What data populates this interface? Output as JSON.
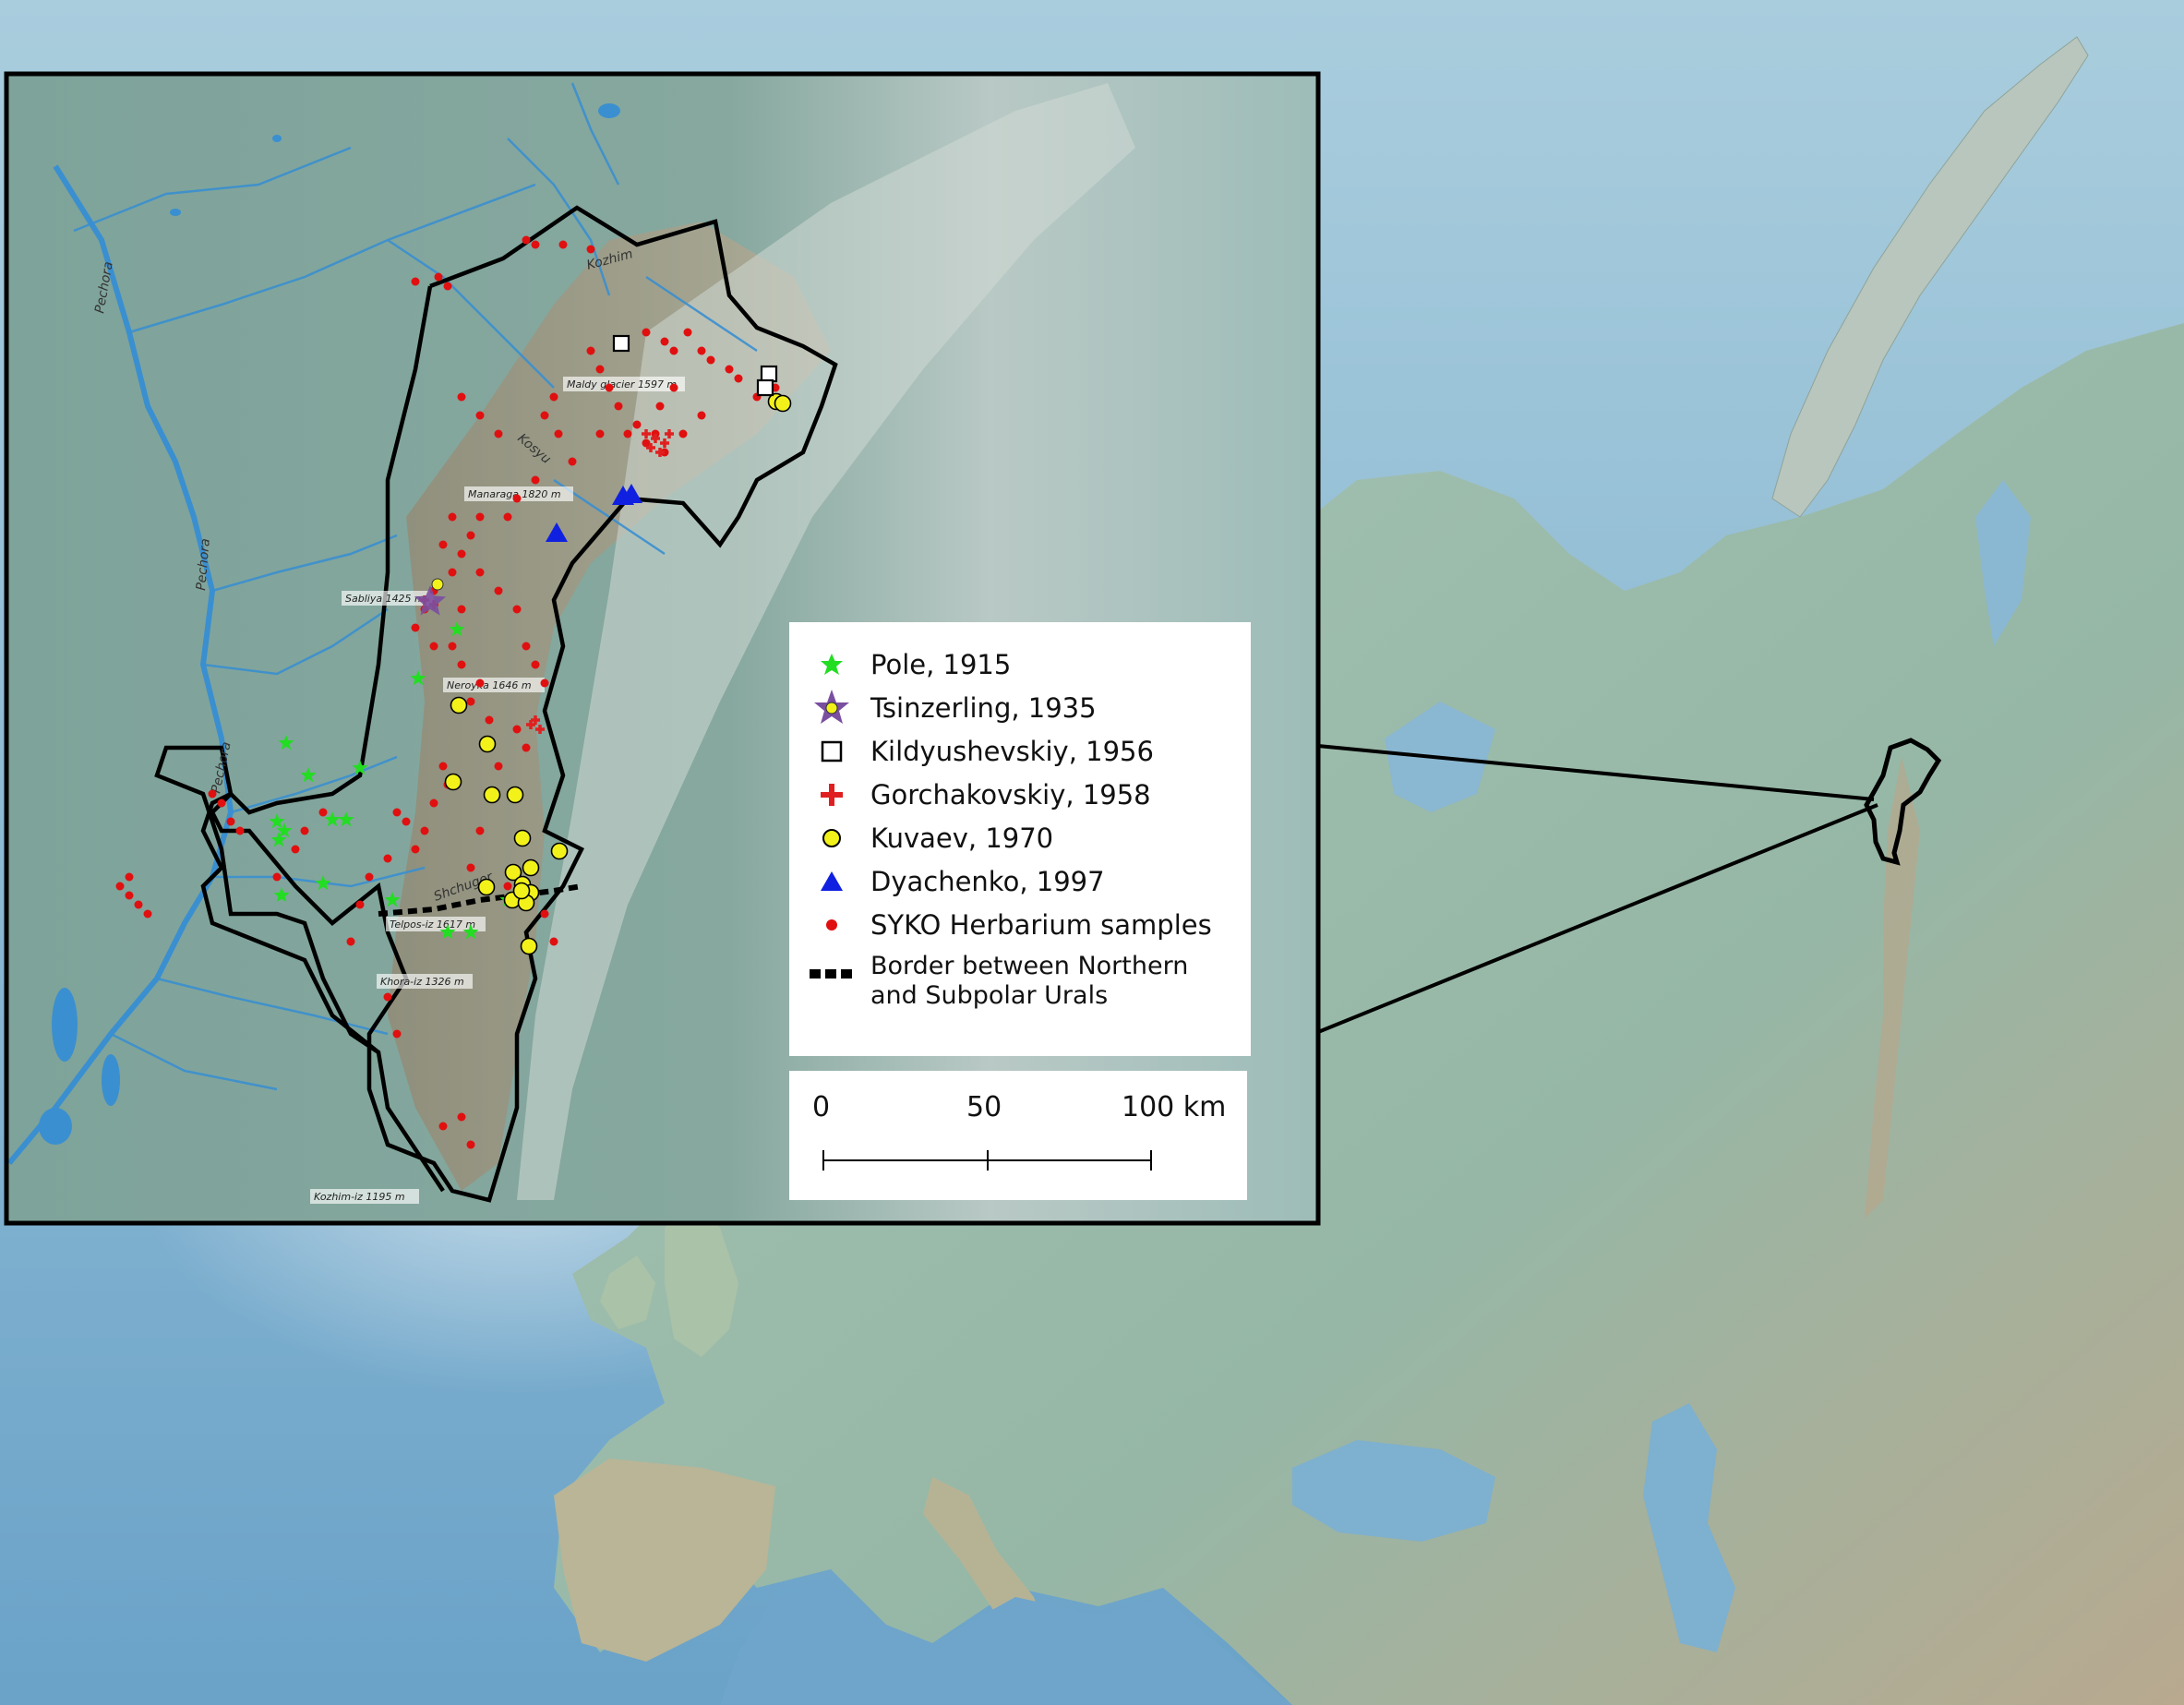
{
  "peaks": [
    {
      "id": "maldy",
      "label": "Maldy glacier 1597 m"
    },
    {
      "id": "manaraga",
      "label": "Manaraga 1820 m"
    },
    {
      "id": "sabliya",
      "label": "Sabliya 1425 m"
    },
    {
      "id": "neroyka",
      "label": "Neroyka 1646 m"
    },
    {
      "id": "telpos",
      "label": "Telpos-iz 1617 m"
    },
    {
      "id": "khora",
      "label": "Khora-iz 1326 m"
    },
    {
      "id": "kozhim",
      "label": "Kozhim-iz 1195 m"
    }
  ],
  "rivers": [
    {
      "id": "pechora1",
      "label": "Pechora"
    },
    {
      "id": "pechora2",
      "label": "Pechora"
    },
    {
      "id": "pechora3",
      "label": "Pechora"
    },
    {
      "id": "kozhim_river",
      "label": "Kozhim"
    },
    {
      "id": "kosyu",
      "label": "Kosyu"
    },
    {
      "id": "shchugor",
      "label": "Shchugor"
    }
  ],
  "legend": {
    "items": [
      {
        "id": "pole",
        "label": "Pole, 1915",
        "symbol": "star-small",
        "color": "#22dd22"
      },
      {
        "id": "tsinzerling",
        "label": "Tsinzerling, 1935",
        "symbol": "star-large",
        "color": "#7a4fa0"
      },
      {
        "id": "kildyushevskiy",
        "label": "Kildyushevskiy, 1956",
        "symbol": "square-open",
        "color": "#000000"
      },
      {
        "id": "gorchakovskiy",
        "label": "Gorchakovskiy, 1958",
        "symbol": "cross",
        "color": "#e02020"
      },
      {
        "id": "kuvaev",
        "label": "Kuvaev, 1970",
        "symbol": "circle",
        "color": "#f2f21a"
      },
      {
        "id": "dyachenko",
        "label": "Dyachenko, 1997",
        "symbol": "triangle",
        "color": "#1020e0"
      },
      {
        "id": "syko",
        "label": "SYKO Herbarium samples",
        "symbol": "dot",
        "color": "#e01010"
      }
    ],
    "border": {
      "line1": "Border between Northern",
      "line2": "and Subpolar Urals"
    }
  },
  "scale": {
    "tick0": "0",
    "tick1": "50",
    "tick2": "100 km"
  },
  "colors": {
    "sea": "#8fb9cf",
    "land": "#9fbdab",
    "inset_land": "#87aaa0",
    "rivers": "#3a8fd0",
    "boundary": "#000000"
  }
}
